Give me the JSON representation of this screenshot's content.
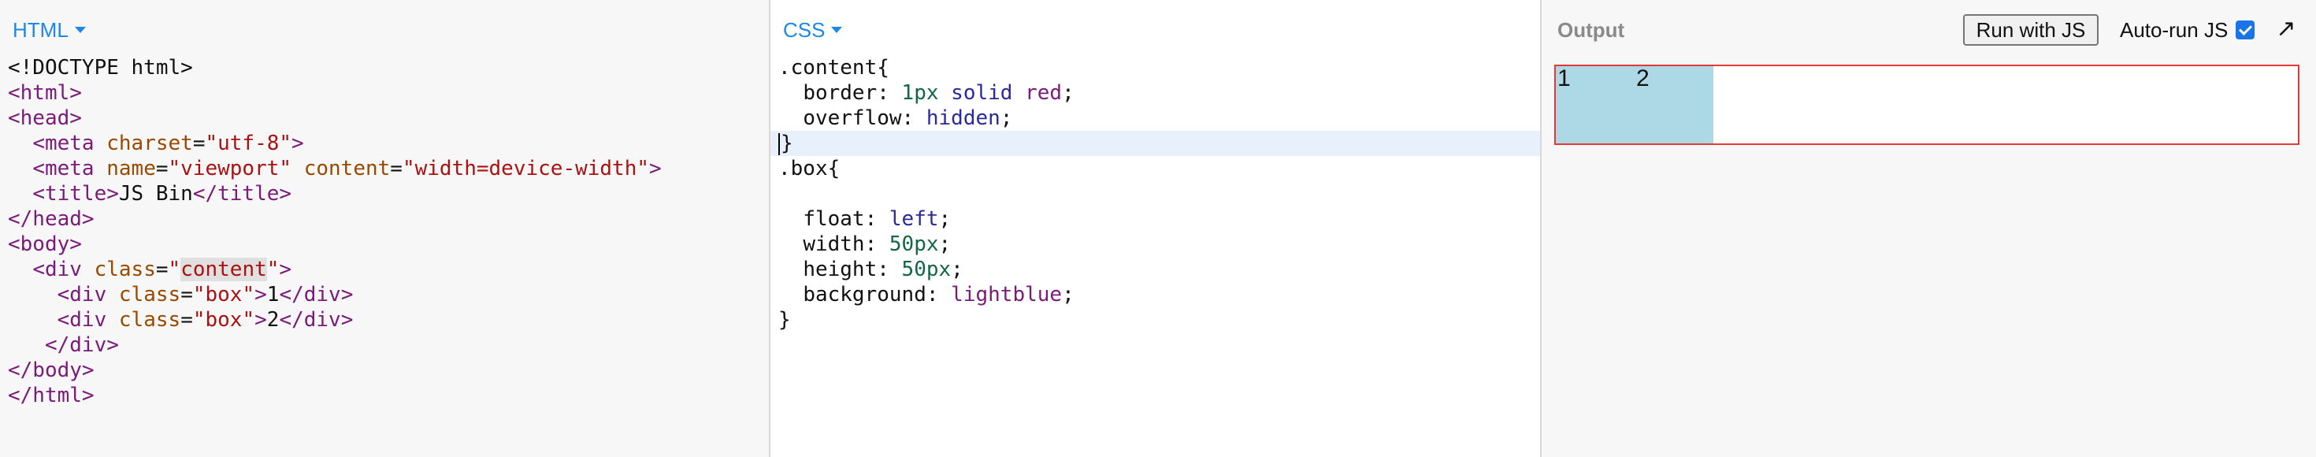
{
  "html_panel": {
    "label": "HTML",
    "code_lines": [
      [
        {
          "t": "<!DOCTYPE html>",
          "c": "plain"
        }
      ],
      [
        {
          "t": "<html>",
          "c": "tag"
        }
      ],
      [
        {
          "t": "<head>",
          "c": "tag"
        }
      ],
      [
        {
          "t": "  "
        },
        {
          "t": "<meta ",
          "c": "tag"
        },
        {
          "t": "charset",
          "c": "attr"
        },
        {
          "t": "=",
          "c": "plain"
        },
        {
          "t": "\"utf-8\"",
          "c": "str"
        },
        {
          "t": ">",
          "c": "tag"
        }
      ],
      [
        {
          "t": "  "
        },
        {
          "t": "<meta ",
          "c": "tag"
        },
        {
          "t": "name",
          "c": "attr"
        },
        {
          "t": "=",
          "c": "plain"
        },
        {
          "t": "\"viewport\"",
          "c": "str"
        },
        {
          "t": " "
        },
        {
          "t": "content",
          "c": "attr"
        },
        {
          "t": "=",
          "c": "plain"
        },
        {
          "t": "\"width=device-width\"",
          "c": "str"
        },
        {
          "t": ">",
          "c": "tag"
        }
      ],
      [
        {
          "t": "  "
        },
        {
          "t": "<title>",
          "c": "tag"
        },
        {
          "t": "JS Bin",
          "c": "plain"
        },
        {
          "t": "</title>",
          "c": "tag"
        }
      ],
      [
        {
          "t": "</head>",
          "c": "tag"
        }
      ],
      [
        {
          "t": "<body>",
          "c": "tag"
        }
      ],
      [
        {
          "t": "  "
        },
        {
          "t": "<div ",
          "c": "tag"
        },
        {
          "t": "class",
          "c": "attr"
        },
        {
          "t": "=",
          "c": "plain"
        },
        {
          "t": "\"",
          "c": "str"
        },
        {
          "t": "content",
          "c": "str sel"
        },
        {
          "t": "\"",
          "c": "str"
        },
        {
          "t": ">",
          "c": "tag"
        }
      ],
      [
        {
          "t": "    "
        },
        {
          "t": "<div ",
          "c": "tag"
        },
        {
          "t": "class",
          "c": "attr"
        },
        {
          "t": "=",
          "c": "plain"
        },
        {
          "t": "\"box\"",
          "c": "str"
        },
        {
          "t": ">",
          "c": "tag"
        },
        {
          "t": "1",
          "c": "plain"
        },
        {
          "t": "</div>",
          "c": "tag"
        }
      ],
      [
        {
          "t": "    "
        },
        {
          "t": "<div ",
          "c": "tag"
        },
        {
          "t": "class",
          "c": "attr"
        },
        {
          "t": "=",
          "c": "plain"
        },
        {
          "t": "\"box\"",
          "c": "str"
        },
        {
          "t": ">",
          "c": "tag"
        },
        {
          "t": "2",
          "c": "plain"
        },
        {
          "t": "</div>",
          "c": "tag"
        }
      ],
      [
        {
          "t": "   "
        },
        {
          "t": "</div>",
          "c": "tag"
        }
      ],
      [
        {
          "t": "</body>",
          "c": "tag"
        }
      ],
      [
        {
          "t": "</html>",
          "c": "tag"
        }
      ]
    ]
  },
  "css_panel": {
    "label": "CSS",
    "active_line": 3,
    "code_lines": [
      [
        {
          "t": ".content{",
          "c": "plain"
        }
      ],
      [
        {
          "t": "  "
        },
        {
          "t": "border",
          "c": "prop"
        },
        {
          "t": ": ",
          "c": "plain"
        },
        {
          "t": "1px",
          "c": "num"
        },
        {
          "t": " "
        },
        {
          "t": "solid",
          "c": "kw"
        },
        {
          "t": " "
        },
        {
          "t": "red",
          "c": "kw2"
        },
        {
          "t": ";",
          "c": "plain"
        }
      ],
      [
        {
          "t": "  "
        },
        {
          "t": "overflow",
          "c": "prop"
        },
        {
          "t": ": ",
          "c": "plain"
        },
        {
          "t": "hidden",
          "c": "kw"
        },
        {
          "t": ";",
          "c": "plain"
        }
      ],
      [
        {
          "t": "}",
          "c": "plain",
          "cursor": true
        }
      ],
      [
        {
          "t": ".box{",
          "c": "plain"
        }
      ],
      [
        {
          "t": ""
        }
      ],
      [
        {
          "t": "  "
        },
        {
          "t": "float",
          "c": "prop"
        },
        {
          "t": ": ",
          "c": "plain"
        },
        {
          "t": "left",
          "c": "kw"
        },
        {
          "t": ";",
          "c": "plain"
        }
      ],
      [
        {
          "t": "  "
        },
        {
          "t": "width",
          "c": "prop"
        },
        {
          "t": ": ",
          "c": "plain"
        },
        {
          "t": "50px",
          "c": "num"
        },
        {
          "t": ";",
          "c": "plain"
        }
      ],
      [
        {
          "t": "  "
        },
        {
          "t": "height",
          "c": "prop"
        },
        {
          "t": ": ",
          "c": "plain"
        },
        {
          "t": "50px",
          "c": "num"
        },
        {
          "t": ";",
          "c": "plain"
        }
      ],
      [
        {
          "t": "  "
        },
        {
          "t": "background",
          "c": "prop"
        },
        {
          "t": ": ",
          "c": "plain"
        },
        {
          "t": "lightblue",
          "c": "kw2"
        },
        {
          "t": ";",
          "c": "plain"
        }
      ],
      [
        {
          "t": "}",
          "c": "plain"
        }
      ]
    ]
  },
  "output_panel": {
    "title": "Output",
    "run_button": "Run with JS",
    "autorun_label": "Auto-run JS",
    "autorun_checked": true,
    "expand_icon": "expand-arrow-icon",
    "boxes": [
      "1",
      "2"
    ],
    "frame_border_color": "#e53935",
    "box_color": "#add8e6"
  },
  "colors": {
    "accent": "#1e88e5"
  }
}
